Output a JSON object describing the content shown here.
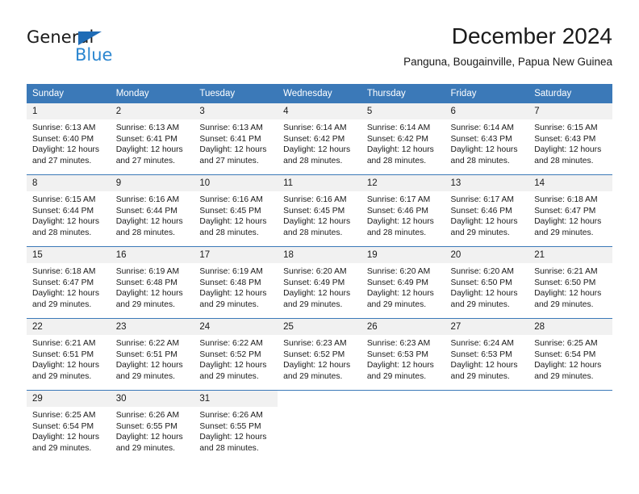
{
  "brand": {
    "name_top": "General",
    "name_bottom": "Blue",
    "accent_dark": "#1f6cb6",
    "accent_light": "#2b86d0"
  },
  "header": {
    "title": "December 2024",
    "subtitle": "Panguna, Bougainville, Papua New Guinea"
  },
  "theme": {
    "header_blue": "#3b79b8",
    "date_band": "#f1f1f1",
    "text": "#1a1a1a"
  },
  "calendar": {
    "weekdays": [
      "Sunday",
      "Monday",
      "Tuesday",
      "Wednesday",
      "Thursday",
      "Friday",
      "Saturday"
    ],
    "weeks": [
      [
        {
          "day": "1",
          "sunrise": "Sunrise: 6:13 AM",
          "sunset": "Sunset: 6:40 PM",
          "daylight": "Daylight: 12 hours and 27 minutes."
        },
        {
          "day": "2",
          "sunrise": "Sunrise: 6:13 AM",
          "sunset": "Sunset: 6:41 PM",
          "daylight": "Daylight: 12 hours and 27 minutes."
        },
        {
          "day": "3",
          "sunrise": "Sunrise: 6:13 AM",
          "sunset": "Sunset: 6:41 PM",
          "daylight": "Daylight: 12 hours and 27 minutes."
        },
        {
          "day": "4",
          "sunrise": "Sunrise: 6:14 AM",
          "sunset": "Sunset: 6:42 PM",
          "daylight": "Daylight: 12 hours and 28 minutes."
        },
        {
          "day": "5",
          "sunrise": "Sunrise: 6:14 AM",
          "sunset": "Sunset: 6:42 PM",
          "daylight": "Daylight: 12 hours and 28 minutes."
        },
        {
          "day": "6",
          "sunrise": "Sunrise: 6:14 AM",
          "sunset": "Sunset: 6:43 PM",
          "daylight": "Daylight: 12 hours and 28 minutes."
        },
        {
          "day": "7",
          "sunrise": "Sunrise: 6:15 AM",
          "sunset": "Sunset: 6:43 PM",
          "daylight": "Daylight: 12 hours and 28 minutes."
        }
      ],
      [
        {
          "day": "8",
          "sunrise": "Sunrise: 6:15 AM",
          "sunset": "Sunset: 6:44 PM",
          "daylight": "Daylight: 12 hours and 28 minutes."
        },
        {
          "day": "9",
          "sunrise": "Sunrise: 6:16 AM",
          "sunset": "Sunset: 6:44 PM",
          "daylight": "Daylight: 12 hours and 28 minutes."
        },
        {
          "day": "10",
          "sunrise": "Sunrise: 6:16 AM",
          "sunset": "Sunset: 6:45 PM",
          "daylight": "Daylight: 12 hours and 28 minutes."
        },
        {
          "day": "11",
          "sunrise": "Sunrise: 6:16 AM",
          "sunset": "Sunset: 6:45 PM",
          "daylight": "Daylight: 12 hours and 28 minutes."
        },
        {
          "day": "12",
          "sunrise": "Sunrise: 6:17 AM",
          "sunset": "Sunset: 6:46 PM",
          "daylight": "Daylight: 12 hours and 28 minutes."
        },
        {
          "day": "13",
          "sunrise": "Sunrise: 6:17 AM",
          "sunset": "Sunset: 6:46 PM",
          "daylight": "Daylight: 12 hours and 29 minutes."
        },
        {
          "day": "14",
          "sunrise": "Sunrise: 6:18 AM",
          "sunset": "Sunset: 6:47 PM",
          "daylight": "Daylight: 12 hours and 29 minutes."
        }
      ],
      [
        {
          "day": "15",
          "sunrise": "Sunrise: 6:18 AM",
          "sunset": "Sunset: 6:47 PM",
          "daylight": "Daylight: 12 hours and 29 minutes."
        },
        {
          "day": "16",
          "sunrise": "Sunrise: 6:19 AM",
          "sunset": "Sunset: 6:48 PM",
          "daylight": "Daylight: 12 hours and 29 minutes."
        },
        {
          "day": "17",
          "sunrise": "Sunrise: 6:19 AM",
          "sunset": "Sunset: 6:48 PM",
          "daylight": "Daylight: 12 hours and 29 minutes."
        },
        {
          "day": "18",
          "sunrise": "Sunrise: 6:20 AM",
          "sunset": "Sunset: 6:49 PM",
          "daylight": "Daylight: 12 hours and 29 minutes."
        },
        {
          "day": "19",
          "sunrise": "Sunrise: 6:20 AM",
          "sunset": "Sunset: 6:49 PM",
          "daylight": "Daylight: 12 hours and 29 minutes."
        },
        {
          "day": "20",
          "sunrise": "Sunrise: 6:20 AM",
          "sunset": "Sunset: 6:50 PM",
          "daylight": "Daylight: 12 hours and 29 minutes."
        },
        {
          "day": "21",
          "sunrise": "Sunrise: 6:21 AM",
          "sunset": "Sunset: 6:50 PM",
          "daylight": "Daylight: 12 hours and 29 minutes."
        }
      ],
      [
        {
          "day": "22",
          "sunrise": "Sunrise: 6:21 AM",
          "sunset": "Sunset: 6:51 PM",
          "daylight": "Daylight: 12 hours and 29 minutes."
        },
        {
          "day": "23",
          "sunrise": "Sunrise: 6:22 AM",
          "sunset": "Sunset: 6:51 PM",
          "daylight": "Daylight: 12 hours and 29 minutes."
        },
        {
          "day": "24",
          "sunrise": "Sunrise: 6:22 AM",
          "sunset": "Sunset: 6:52 PM",
          "daylight": "Daylight: 12 hours and 29 minutes."
        },
        {
          "day": "25",
          "sunrise": "Sunrise: 6:23 AM",
          "sunset": "Sunset: 6:52 PM",
          "daylight": "Daylight: 12 hours and 29 minutes."
        },
        {
          "day": "26",
          "sunrise": "Sunrise: 6:23 AM",
          "sunset": "Sunset: 6:53 PM",
          "daylight": "Daylight: 12 hours and 29 minutes."
        },
        {
          "day": "27",
          "sunrise": "Sunrise: 6:24 AM",
          "sunset": "Sunset: 6:53 PM",
          "daylight": "Daylight: 12 hours and 29 minutes."
        },
        {
          "day": "28",
          "sunrise": "Sunrise: 6:25 AM",
          "sunset": "Sunset: 6:54 PM",
          "daylight": "Daylight: 12 hours and 29 minutes."
        }
      ],
      [
        {
          "day": "29",
          "sunrise": "Sunrise: 6:25 AM",
          "sunset": "Sunset: 6:54 PM",
          "daylight": "Daylight: 12 hours and 29 minutes."
        },
        {
          "day": "30",
          "sunrise": "Sunrise: 6:26 AM",
          "sunset": "Sunset: 6:55 PM",
          "daylight": "Daylight: 12 hours and 29 minutes."
        },
        {
          "day": "31",
          "sunrise": "Sunrise: 6:26 AM",
          "sunset": "Sunset: 6:55 PM",
          "daylight": "Daylight: 12 hours and 28 minutes."
        },
        null,
        null,
        null,
        null
      ]
    ]
  }
}
